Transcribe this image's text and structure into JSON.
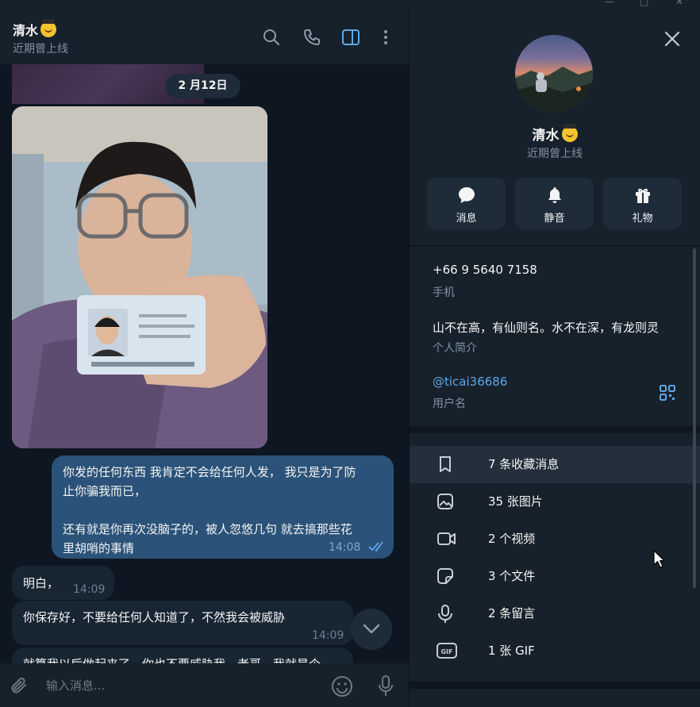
{
  "window": {
    "minimize_glyph": "—",
    "maximize_glyph": "□",
    "close_glyph": "✕"
  },
  "chat": {
    "contact_name": "清水",
    "contact_status": "近期曾上线",
    "date_separator": "2 月12日",
    "messages": [
      {
        "direction": "out",
        "lines": [
          "你发的任何东西 我肯定不会给任何人发，  我只是为了防",
          "止你骗我而已，",
          "",
          "还有就是你再次没脑子的，被人忽悠几句 就去搞那些花",
          "里胡哨的事情"
        ],
        "time": "14:08",
        "read": true
      },
      {
        "direction": "in",
        "lines": [
          "明白，"
        ],
        "time": "14:09"
      },
      {
        "direction": "in",
        "lines": [
          "你保存好，不要给任何人知道了，不然我会被威胁"
        ],
        "time": "14:09"
      },
      {
        "direction": "in",
        "lines": [
          "就算我以后做起来了，你也不要威胁我，老哥，我就是个"
        ],
        "time": ""
      }
    ],
    "composer": {
      "placeholder": "输入消息..."
    }
  },
  "profile": {
    "name": "清水",
    "status": "近期曾上线",
    "actions": [
      {
        "label": "消息",
        "icon": "message-icon"
      },
      {
        "label": "静音",
        "icon": "bell-icon"
      },
      {
        "label": "礼物",
        "icon": "gift-icon"
      }
    ],
    "phone": {
      "value": "+66 9 5640 7158",
      "label": "手机"
    },
    "bio": {
      "value": "山不在高，有仙则名。水不在深，有龙则灵",
      "label": "个人简介"
    },
    "username": {
      "value": "@ticai36686",
      "label": "用户名"
    },
    "media": [
      {
        "label": "7 条收藏消息",
        "icon": "bookmark-icon"
      },
      {
        "label": "35 张图片",
        "icon": "image-icon"
      },
      {
        "label": "2 个视频",
        "icon": "video-icon"
      },
      {
        "label": "3 个文件",
        "icon": "file-icon"
      },
      {
        "label": "2 条留言",
        "icon": "microphone-icon"
      },
      {
        "label": "1 张 GIF",
        "icon": "gif-icon",
        "badge": "GIF"
      }
    ]
  },
  "colors": {
    "accent": "#5fa8e8",
    "outgoing_bubble": "#2b5278",
    "incoming_bubble": "#182533",
    "panel": "#17212b",
    "background": "#0e1621"
  }
}
